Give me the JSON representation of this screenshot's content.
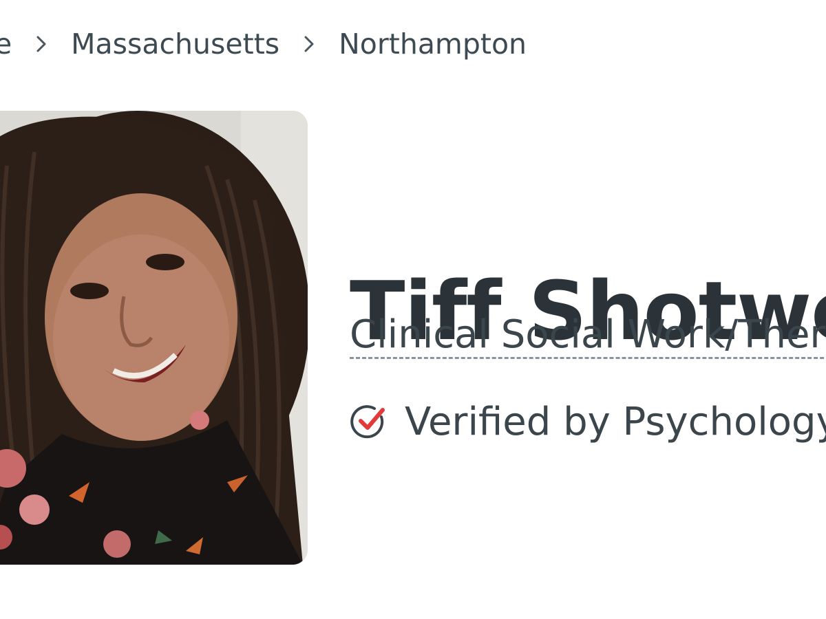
{
  "breadcrumb": {
    "items": [
      "me",
      "Massachusetts",
      "Northampton"
    ]
  },
  "profile": {
    "name": "Tiff Shotwell",
    "title": "Clinical Social Work/Therap",
    "verified_text": "Verified by Psychology"
  },
  "colors": {
    "accent_check": "#e23a3a",
    "badge_blue": "#3f7de0",
    "text": "#333a40"
  },
  "icons": {
    "breadcrumb_separator": "chevron-right-icon",
    "verified": "check-circle-icon",
    "badge": "verified-badge-icon"
  }
}
